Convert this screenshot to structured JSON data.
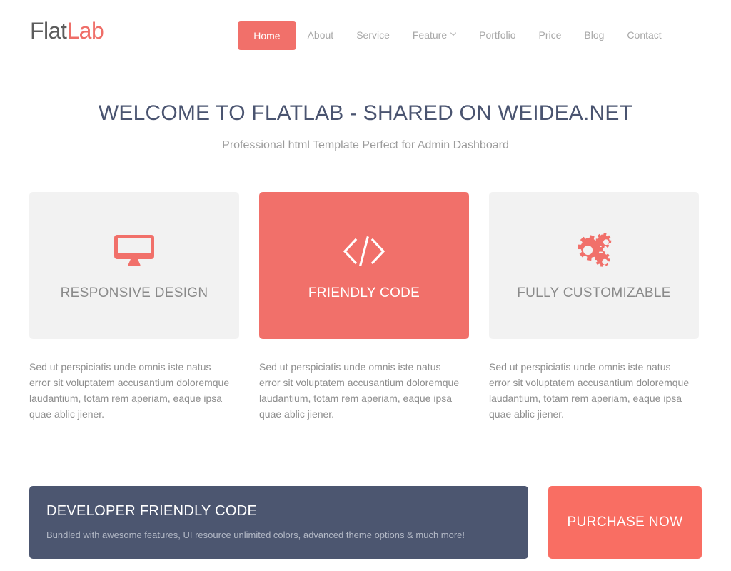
{
  "brand": {
    "name_first": "Flat",
    "name_second": "Lab",
    "color_first": "#5c5c5c",
    "color_second": "#ef6e68"
  },
  "nav": {
    "items": [
      {
        "label": "Home",
        "active": true,
        "caret": false
      },
      {
        "label": "About",
        "active": false,
        "caret": false
      },
      {
        "label": "Service",
        "active": false,
        "caret": false
      },
      {
        "label": "Feature",
        "active": false,
        "caret": true
      },
      {
        "label": "Portfolio",
        "active": false,
        "caret": false
      },
      {
        "label": "Price",
        "active": false,
        "caret": false
      },
      {
        "label": "Blog",
        "active": false,
        "caret": false
      },
      {
        "label": "Contact",
        "active": false,
        "caret": false
      }
    ]
  },
  "hero": {
    "title": "WELCOME TO FLATLAB - SHARED ON WEIDEA.NET",
    "subtitle": "Professional html Template Perfect for Admin Dashboard",
    "title_color": "#4a5470"
  },
  "features": [
    {
      "title": "RESPONSIVE DESIGN",
      "icon": "desktop-monitor-icon",
      "style": "light",
      "text": "Sed ut perspiciatis unde omnis iste natus error sit voluptatem accusantium doloremque laudantium, totam rem aperiam, eaque ipsa quae ablic jiener."
    },
    {
      "title": "FRIENDLY CODE",
      "icon": "code-brackets-icon",
      "style": "accent",
      "text": "Sed ut perspiciatis unde omnis iste natus error sit voluptatem accusantium doloremque laudantium, totam rem aperiam, eaque ipsa quae ablic jiener."
    },
    {
      "title": "FULLY CUSTOMIZABLE",
      "icon": "gears-icon",
      "style": "light",
      "text": "Sed ut perspiciatis unde omnis iste natus error sit voluptatem accusantium doloremque laudantium, totam rem aperiam, eaque ipsa quae ablic jiener."
    }
  ],
  "cta": {
    "banner_title": "DEVELOPER FRIENDLY CODE",
    "banner_subtitle": "Bundled with awesome features, UI resource unlimited colors, advanced theme options & much more!",
    "button_label": "PURCHASE NOW",
    "banner_color": "#4c5670",
    "button_color": "#f96e63"
  },
  "colors": {
    "accent": "#f1706a",
    "tile_light": "#f2f2f2",
    "body_text": "#8d8d8d"
  }
}
